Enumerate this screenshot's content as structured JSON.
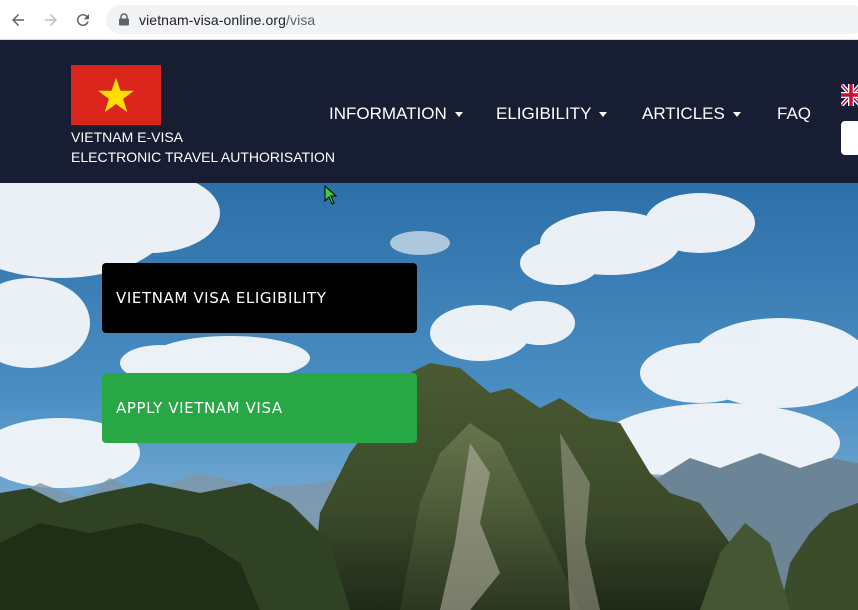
{
  "browser": {
    "url_host": "vietnam-visa-online.org",
    "url_path": "/visa"
  },
  "header": {
    "brand_line1": "VIETNAM E-VISA",
    "brand_line2": "ELECTRONIC TRAVEL AUTHORISATION",
    "menu": [
      {
        "label": "INFORMATION",
        "dropdown": true
      },
      {
        "label": "ELIGIBILITY",
        "dropdown": true
      },
      {
        "label": "ARTICLES",
        "dropdown": true
      },
      {
        "label": "FAQ",
        "dropdown": false
      }
    ]
  },
  "hero": {
    "eligibility_button": "VIETNAM VISA ELIGIBILITY",
    "apply_button": "APPLY VIETNAM VISA"
  },
  "colors": {
    "header_bg": "#171e33",
    "flag_red": "#da251d",
    "flag_star": "#ffde00",
    "apply_green": "#28a745",
    "eligibility_black": "#000000"
  }
}
